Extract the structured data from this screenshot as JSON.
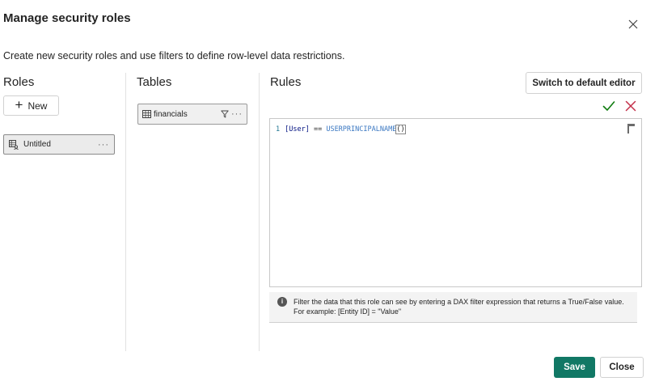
{
  "dialog": {
    "title": "Manage security roles",
    "subtitle": "Create new security roles and use filters to define row-level data restrictions."
  },
  "roles": {
    "heading": "Roles",
    "new_label": "New",
    "items": [
      {
        "label": "Untitled",
        "more": "···"
      }
    ]
  },
  "tables": {
    "heading": "Tables",
    "items": [
      {
        "label": "financials",
        "more": "···"
      }
    ]
  },
  "rules": {
    "heading": "Rules",
    "switch_label": "Switch to default editor",
    "editor": {
      "line_number": "1",
      "column_token": "[User]",
      "operator_token": " == ",
      "function_token": "USERPRINCIPALNAME",
      "paren_token": "()"
    },
    "info_text": "Filter the data that this role can see by entering a DAX filter expression that returns a True/False value. For example: [Entity ID] = \"Value\""
  },
  "footer": {
    "save_label": "Save",
    "close_label": "Close"
  },
  "colors": {
    "primary": "#117865",
    "check": "#107c10",
    "cancel": "#c4314b"
  },
  "icons": {
    "close": "close-icon",
    "plus": "plus-icon",
    "role": "role-icon",
    "table": "table-icon",
    "filter": "filter-icon",
    "check": "check-icon",
    "cancel": "cancel-icon",
    "info": "info-icon"
  }
}
